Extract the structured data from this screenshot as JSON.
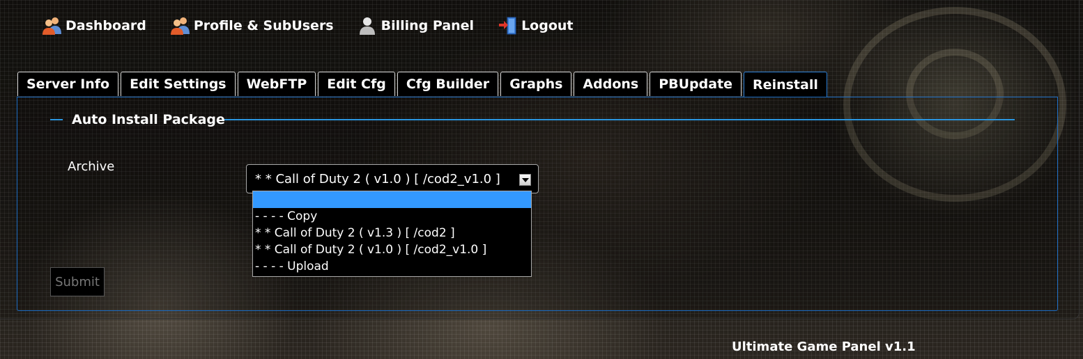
{
  "nav": {
    "items": [
      {
        "label": "Dashboard",
        "icon": "users-icon"
      },
      {
        "label": "Profile & SubUsers",
        "icon": "users-icon"
      },
      {
        "label": "Billing Panel",
        "icon": "user-icon"
      },
      {
        "label": "Logout",
        "icon": "logout-door-icon"
      }
    ]
  },
  "tabs": [
    {
      "label": "Server Info"
    },
    {
      "label": "Edit Settings"
    },
    {
      "label": "WebFTP"
    },
    {
      "label": "Edit Cfg"
    },
    {
      "label": "Cfg Builder"
    },
    {
      "label": "Graphs"
    },
    {
      "label": "Addons"
    },
    {
      "label": "PBUpdate"
    },
    {
      "label": "Reinstall",
      "active": true
    }
  ],
  "form": {
    "legend": "Auto Install Package",
    "archive_label": "Archive",
    "archive_value": "* * Call of Duty 2 ( v1.0 ) [ /cod2_v1.0 ]",
    "options": [
      "",
      "- - - - Copy",
      "* * Call of Duty 2 ( v1.3 ) [ /cod2 ]",
      "* * Call of Duty 2 ( v1.0 ) [ /cod2_v1.0 ]",
      "- - - - Upload"
    ],
    "submit_label": "Submit"
  },
  "footer": {
    "brand": "Ultimate Game Panel v1.1"
  },
  "colors": {
    "accent": "#2b96e0",
    "panel_border": "#1e6ec4",
    "selected_option": "#3399ff"
  }
}
